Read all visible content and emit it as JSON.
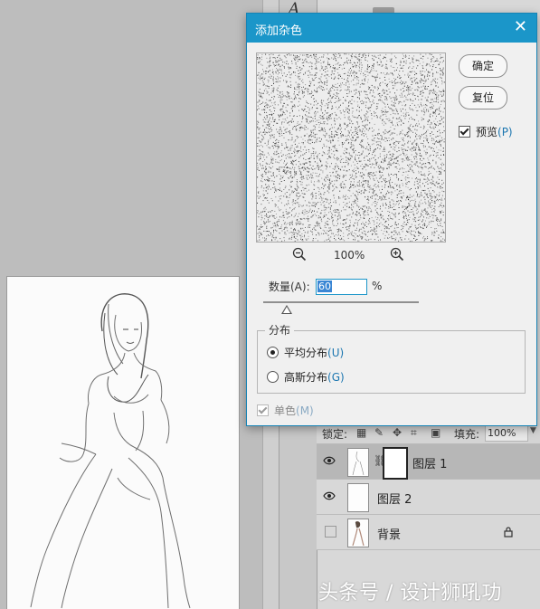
{
  "dialog": {
    "title": "添加杂色",
    "zoom": "100%",
    "ok_button": "确定",
    "reset_button": "复位",
    "preview_label": "预览",
    "preview_key": "(P)",
    "preview_checked": true,
    "amount_label": "数量(A):",
    "amount_value": "60",
    "amount_unit": "%",
    "distribution_label": "分布",
    "options": [
      {
        "label": "平均分布",
        "key": "(U)",
        "checked": true
      },
      {
        "label": "高斯分布",
        "key": "(G)",
        "checked": false
      }
    ],
    "monochrome_label": "单色",
    "monochrome_key": "(M)",
    "monochrome_checked": true
  },
  "layers_panel": {
    "lock_label": "锁定:",
    "fill_label": "填充:",
    "fill_value": "100%",
    "layers": [
      {
        "name": "图层 1",
        "visible": true,
        "selected": true
      },
      {
        "name": "图层 2",
        "visible": true,
        "selected": false
      },
      {
        "name": "背景",
        "visible": false,
        "selected": false,
        "locked": true
      }
    ]
  },
  "tools": {
    "type_tool_glyph": "A"
  },
  "watermark": "头条号 / 设计狮吼功",
  "colors": {
    "title_bar": "#1b96c9",
    "accent": "#1b76b0"
  }
}
